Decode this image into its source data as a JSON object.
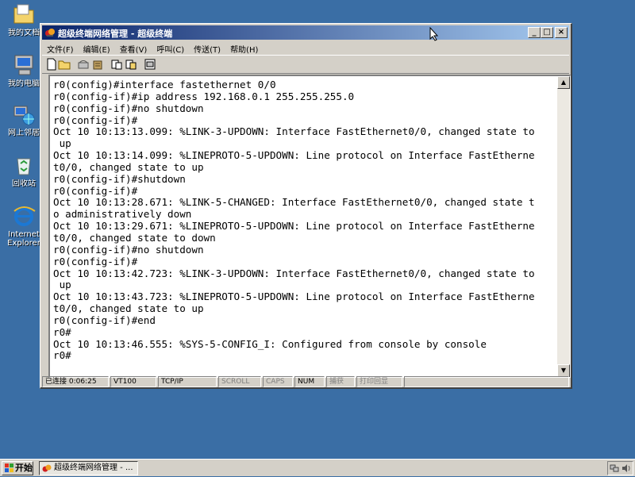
{
  "desktop": {
    "icons": [
      {
        "label": "我的文档",
        "icon": "my-documents-icon"
      },
      {
        "label": "我的电脑",
        "icon": "my-computer-icon"
      },
      {
        "label": "网上邻居",
        "icon": "network-places-icon"
      },
      {
        "label": "回收站",
        "icon": "recycle-bin-icon"
      },
      {
        "label": "Internet",
        "label2": "Explorer",
        "icon": "internet-explorer-icon"
      }
    ],
    "background_color": "#3a6ea5"
  },
  "window": {
    "title": "超级终端网络管理 - 超级终端",
    "controls": {
      "minimize": "_",
      "maximize": "□",
      "close": "×"
    },
    "menu": [
      "文件(F)",
      "编辑(E)",
      "查看(V)",
      "呼叫(C)",
      "传送(T)",
      "帮助(H)"
    ],
    "toolbar_icons": [
      "new-icon",
      "open-icon",
      "call-icon",
      "disconnect-icon",
      "send-icon",
      "receive-icon",
      "properties-icon"
    ]
  },
  "terminal": {
    "lines": [
      "r0(config)#interface fastethernet 0/0",
      "r0(config-if)#ip address 192.168.0.1 255.255.255.0",
      "r0(config-if)#no shutdown",
      "r0(config-if)#",
      "Oct 10 10:13:13.099: %LINK-3-UPDOWN: Interface FastEthernet0/0, changed state to",
      " up",
      "Oct 10 10:13:14.099: %LINEPROTO-5-UPDOWN: Line protocol on Interface FastEtherne",
      "t0/0, changed state to up",
      "r0(config-if)#shutdown",
      "r0(config-if)#",
      "Oct 10 10:13:28.671: %LINK-5-CHANGED: Interface FastEthernet0/0, changed state t",
      "o administratively down",
      "Oct 10 10:13:29.671: %LINEPROTO-5-UPDOWN: Line protocol on Interface FastEtherne",
      "t0/0, changed state to down",
      "r0(config-if)#no shutdown",
      "r0(config-if)#",
      "Oct 10 10:13:42.723: %LINK-3-UPDOWN: Interface FastEthernet0/0, changed state to",
      " up",
      "Oct 10 10:13:43.723: %LINEPROTO-5-UPDOWN: Line protocol on Interface FastEtherne",
      "t0/0, changed state to up",
      "r0(config-if)#end",
      "r0#",
      "Oct 10 10:13:46.555: %SYS-5-CONFIG_I: Configured from console by console",
      "r0#"
    ]
  },
  "statusbar": {
    "connected": "已连接 0:06:25",
    "emulation": "VT100",
    "protocol": "TCP/IP",
    "scroll": "SCROLL",
    "caps": "CAPS",
    "num": "NUM",
    "capture": "捕获",
    "echo": "打印回显"
  },
  "taskbar": {
    "start_label": "开始",
    "task_label": "超级终端网络管理 - ..."
  }
}
